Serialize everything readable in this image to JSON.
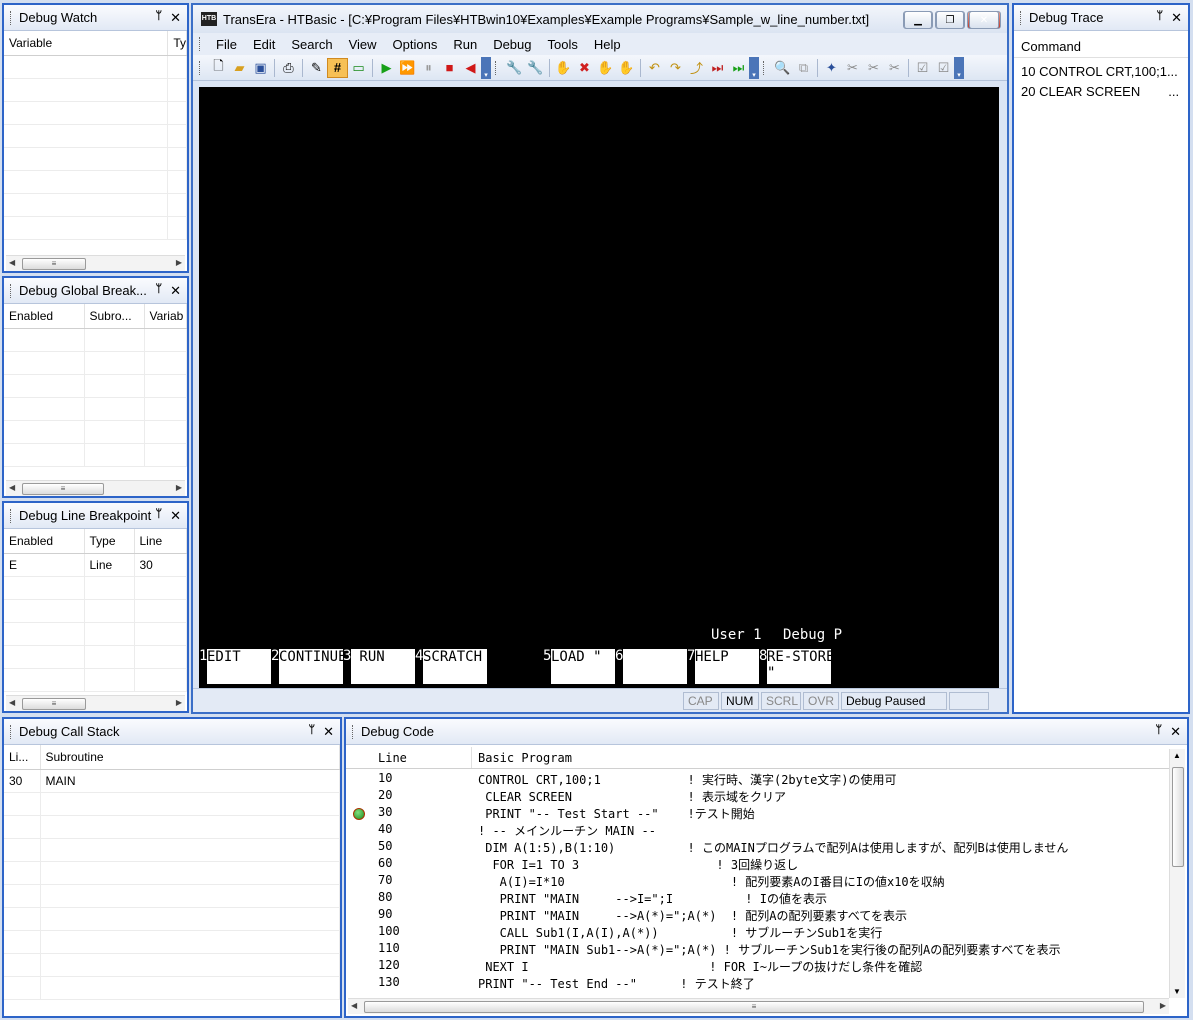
{
  "debug_watch": {
    "title": "Debug Watch",
    "columns": [
      "Variable",
      "Ty"
    ]
  },
  "global_breakpoints": {
    "title": "Debug Global Break...",
    "columns": [
      "Enabled",
      "Subro...",
      "Variab"
    ]
  },
  "line_breakpoint": {
    "title": "Debug Line Breakpoint",
    "columns": [
      "Enabled",
      "Type",
      "Line"
    ],
    "rows": [
      [
        "E",
        "Line",
        "30"
      ]
    ]
  },
  "call_stack": {
    "title": "Debug Call Stack",
    "columns": [
      "Li...",
      "Subroutine"
    ],
    "rows": [
      [
        "30",
        "MAIN"
      ]
    ]
  },
  "debug_trace": {
    "title": "Debug Trace",
    "columns": [
      "Command"
    ],
    "rows": [
      "10 CONTROL CRT,100;1...",
      "20 CLEAR SCREEN"
    ],
    "row2_suffix": "..."
  },
  "window": {
    "title": "TransEra - HTBasic - [C:¥Program Files¥HTBwin10¥Examples¥Example Programs¥Sample_w_line_number.txt]",
    "icon_text": "HTB"
  },
  "menu": [
    "File",
    "Edit",
    "Search",
    "View",
    "Options",
    "Run",
    "Debug",
    "Tools",
    "Help"
  ],
  "screen": {
    "status_user": "User 1",
    "status_debug": "Debug P",
    "softkeys": [
      {
        "num": "1",
        "label": "EDIT"
      },
      {
        "num": "2",
        "label": "CONTINUE"
      },
      {
        "num": "3",
        "label": " RUN"
      },
      {
        "num": "4",
        "label": "SCRATCH"
      },
      {
        "num": "5",
        "label": "LOAD \""
      },
      {
        "num": "6",
        "label": ""
      },
      {
        "num": "7",
        "label": "HELP"
      },
      {
        "num": "8",
        "label": "RE-STORE\n\""
      }
    ]
  },
  "statusbar": {
    "cap": "CAP",
    "num": "NUM",
    "scrl": "SCRL",
    "ovr": "OVR",
    "message": "Debug Paused"
  },
  "debug_code": {
    "title": "Debug Code",
    "col_line": "Line",
    "col_program": "Basic Program",
    "lines": [
      {
        "line": "10",
        "code": "CONTROL CRT,100;1            ! 実行時、漢字(2byte文字)の使用可",
        "bp": false
      },
      {
        "line": "20",
        "code": " CLEAR SCREEN                ! 表示域をクリア",
        "bp": false
      },
      {
        "line": "30",
        "code": " PRINT \"-- Test Start --\"    !テスト開始",
        "bp": true
      },
      {
        "line": "40",
        "code": "! -- メインルーチン MAIN --",
        "bp": false
      },
      {
        "line": "50",
        "code": " DIM A(1:5),B(1:10)          ! このMAINプログラムで配列Aは使用しますが、配列Bは使用しません",
        "bp": false
      },
      {
        "line": "60",
        "code": "  FOR I=1 TO 3                   ! 3回繰り返し",
        "bp": false
      },
      {
        "line": "70",
        "code": "   A(I)=I*10                       ! 配列要素AのI番目にIの値x10を収納",
        "bp": false
      },
      {
        "line": "80",
        "code": "   PRINT \"MAIN     -->I=\";I          ! Iの値を表示",
        "bp": false
      },
      {
        "line": "90",
        "code": "   PRINT \"MAIN     -->A(*)=\";A(*)  ! 配列Aの配列要素すべてを表示",
        "bp": false
      },
      {
        "line": "100",
        "code": "   CALL Sub1(I,A(I),A(*))          ! サブルーチンSub1を実行",
        "bp": false
      },
      {
        "line": "110",
        "code": "   PRINT \"MAIN Sub1-->A(*)=\";A(*) ! サブルーチンSub1を実行後の配列Aの配列要素すべてを表示",
        "bp": false
      },
      {
        "line": "120",
        "code": " NEXT I                         ! FOR I~ループの抜けだし条件を確認",
        "bp": false
      },
      {
        "line": "130",
        "code": "PRINT \"-- Test End --\"      ! テスト終了",
        "bp": false
      }
    ]
  }
}
